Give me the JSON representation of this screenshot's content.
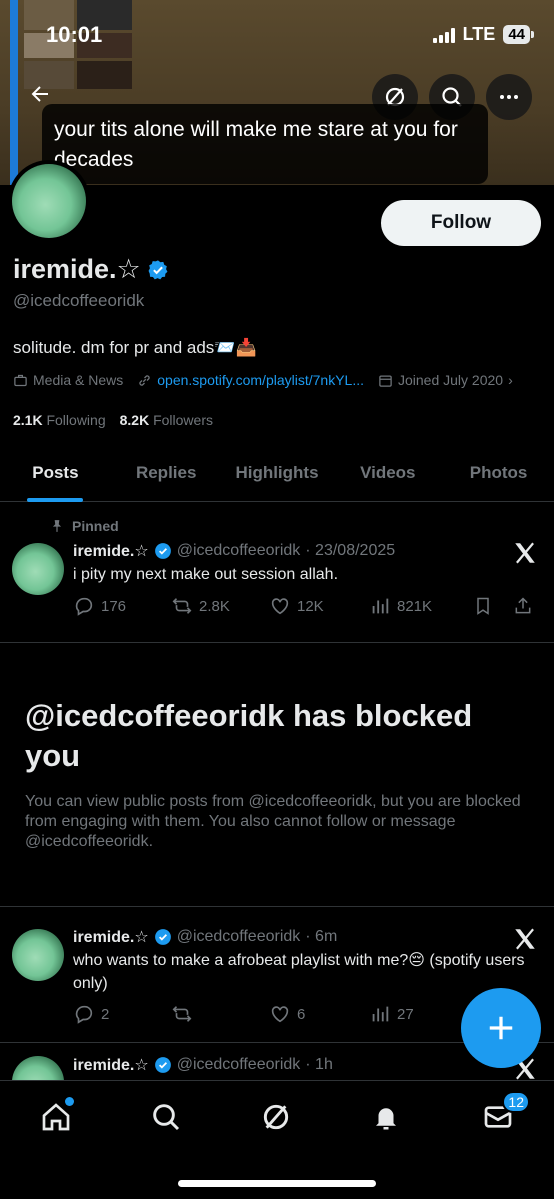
{
  "status": {
    "time": "10:01",
    "network": "LTE",
    "battery": "44"
  },
  "banner": {
    "caption": "your tits alone will make me stare at you for decades"
  },
  "profile": {
    "display_name": "iremide.☆",
    "handle": "@icedcoffeeoridk",
    "bio": "solitude. dm for pr and ads📨📥",
    "category": "Media & News",
    "link": "open.spotify.com/playlist/7nkYL...",
    "joined": "Joined July 2020",
    "following_count": "2.1K",
    "following_label": "Following",
    "followers_count": "8.2K",
    "followers_label": "Followers",
    "follow_button": "Follow"
  },
  "tabs": [
    "Posts",
    "Replies",
    "Highlights",
    "Videos",
    "Photos"
  ],
  "pinned_label": "Pinned",
  "tweets": [
    {
      "name": "iremide.☆",
      "handle": "@icedcoffeeoridk",
      "time": "· 23/08/2025",
      "text": "i pity my next make out session allah.",
      "replies": "176",
      "reposts": "2.8K",
      "likes": "12K",
      "views": "821K"
    },
    {
      "name": "iremide.☆",
      "handle": "@icedcoffeeoridk",
      "time": "· 6m",
      "text": "who wants to make a afrobeat playlist with me?😔 (spotify users only)",
      "replies": "2",
      "reposts": "",
      "likes": "6",
      "views": "27"
    },
    {
      "name": "iremide.☆",
      "handle": "@icedcoffeeoridk",
      "time": "· 1h"
    }
  ],
  "blocked": {
    "title": "@icedcoffeeoridk has blocked you",
    "message": "You can view public posts from @icedcoffeeoridk, but you are blocked from engaging with them. You also cannot follow or message @icedcoffeeoridk."
  },
  "nav": {
    "messages_badge": "12"
  },
  "colors": {
    "accent": "#1d9bf0",
    "background": "#000000",
    "muted": "#71767b"
  }
}
